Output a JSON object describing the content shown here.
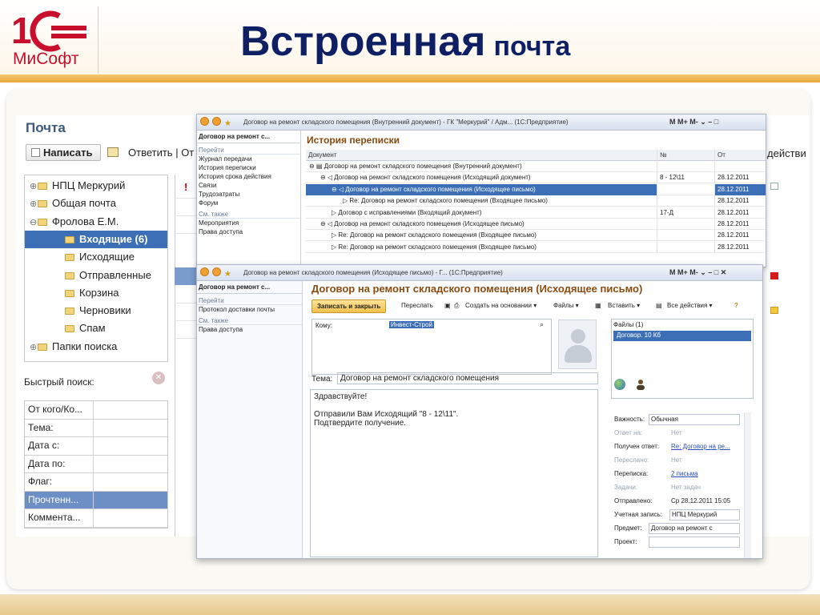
{
  "slide": {
    "title_main": "Встроенная",
    "title_sub": "почта",
    "logo_text": "МиСофт"
  },
  "mail": {
    "title": "Почта",
    "compose_label": "Написать",
    "reply_label": "Ответить",
    "reply_tail": "От",
    "right_edge_label": "действи",
    "folders": [
      {
        "label": "НПЦ Меркурий",
        "expander": "⊕",
        "selected": false,
        "indent": 0
      },
      {
        "label": "Общая почта",
        "expander": "⊕",
        "selected": false,
        "indent": 0
      },
      {
        "label": "Фролова Е.М.",
        "expander": "⊖",
        "selected": false,
        "indent": 0
      },
      {
        "label": "Входящие (6)",
        "expander": "",
        "selected": true,
        "indent": 1
      },
      {
        "label": "Исходящие",
        "expander": "",
        "selected": false,
        "indent": 1
      },
      {
        "label": "Отправленные",
        "expander": "",
        "selected": false,
        "indent": 1
      },
      {
        "label": "Корзина",
        "expander": "",
        "selected": false,
        "indent": 1
      },
      {
        "label": "Черновики",
        "expander": "",
        "selected": false,
        "indent": 1
      },
      {
        "label": "Спам",
        "expander": "",
        "selected": false,
        "indent": 1
      },
      {
        "label": "Папки поиска",
        "expander": "⊕",
        "selected": false,
        "indent": 0
      }
    ],
    "quick_search_label": "Быстрый поиск:",
    "filters": [
      {
        "label": "От кого/Ко...",
        "selected": false
      },
      {
        "label": "Тема:",
        "selected": false
      },
      {
        "label": "Дата с:",
        "selected": false
      },
      {
        "label": "Дата по:",
        "selected": false
      },
      {
        "label": "Флаг:",
        "selected": false
      },
      {
        "label": "Прочтенн...",
        "selected": true
      },
      {
        "label": "Коммента...",
        "selected": false
      }
    ],
    "flag_mark": "!"
  },
  "history_window": {
    "titlebar": "Договор на ремонт складского помещения (Внутренний документ) - ГК \"Меркурий\" / Адм... (1С:Предприятие)",
    "tb_right": "M  M+  M-  ⌄  –  □",
    "nav_head": "Договор на ремонт с...",
    "nav_section1": "Перейти",
    "nav_links1": [
      "Журнал передачи",
      "История переписки",
      "История срока действия",
      "Связи",
      "Трудозатраты",
      "Форум"
    ],
    "nav_section2": "См. также",
    "nav_links2": [
      "Мероприятия",
      "Права доступа"
    ],
    "title": "История переписки",
    "headers": {
      "doc": "Документ",
      "num": "№",
      "date": "От"
    },
    "rows": [
      {
        "doc": "⊖ ▤ Договор на ремонт складского помещения (Внутренний документ)",
        "num": "",
        "date": "",
        "indent": 0,
        "selected": false
      },
      {
        "doc": "⊖ ◁ Договор на ремонт складского помещения (Исходящий документ)",
        "num": "8 - 12\\11",
        "date": "28.12.2011",
        "indent": 1,
        "selected": false
      },
      {
        "doc": "⊖ ◁ Договор на ремонт складского помещения (Исходящее письмо)",
        "num": "",
        "date": "28.12.2011",
        "indent": 2,
        "selected": true
      },
      {
        "doc": "▷ Re: Договор на ремонт складского помещения (Входящее письмо)",
        "num": "",
        "date": "28.12.2011",
        "indent": 3,
        "selected": false
      },
      {
        "doc": "▷ Договор с исправлениями (Входящий документ)",
        "num": "17-Д",
        "date": "28.12.2011",
        "indent": 2,
        "selected": false
      },
      {
        "doc": "⊖ ◁ Договор на ремонт складского помещения (Исходящее письмо)",
        "num": "",
        "date": "28.12.2011",
        "indent": 1,
        "selected": false
      },
      {
        "doc": "▷ Re: Договор на ремонт складского помещения (Входящее письмо)",
        "num": "",
        "date": "28.12.2011",
        "indent": 2,
        "selected": false
      },
      {
        "doc": "▷ Re: Договор на ремонт складского помещения (Входящее письмо)",
        "num": "",
        "date": "28.12.2011",
        "indent": 2,
        "selected": false
      }
    ]
  },
  "letter_window": {
    "titlebar": "Договор на ремонт складского помещения (Исходящее письмо) - Г... (1С:Предприятие)",
    "tb_right": "M  M+  M-  ⌄  –  □  ✕",
    "nav_head": "Договор на ремонт с...",
    "nav_section1": "Перейти",
    "nav_links1": [
      "Протокол доставки почты"
    ],
    "nav_section2": "См. также",
    "nav_links2": [
      "Права доступа"
    ],
    "title": "Договор на ремонт складского помещения (Исходящее письмо)",
    "toolbar": {
      "save_close": "Записать и закрыть",
      "forward": "Переслать",
      "create_based": "Создать на основании ▾",
      "files": "Файлы ▾",
      "insert": "Вставить ▾",
      "all_actions": "Все действия ▾",
      "help": "?"
    },
    "to_label": "Кому:",
    "to_value": "Инвест-Строй",
    "files_head": "Файлы (1)",
    "files_item": "Договор. 10 Кб",
    "subject_label": "Тема:",
    "subject_value": "Договор на ремонт складского помещения",
    "body_lines": [
      "Здравствуйте!",
      "",
      "Отправили Вам Исходящий \"8 - 12\\11\".",
      "Подтвердите получение."
    ],
    "props": [
      {
        "label": "Важность:",
        "value": "Обычная",
        "kind": "field",
        "disabled": false
      },
      {
        "label": "Ответ на:",
        "value": "Нет",
        "kind": "text",
        "disabled": true
      },
      {
        "label": "Получен ответ:",
        "value": "Re: Договор на ре...",
        "kind": "link",
        "disabled": false
      },
      {
        "label": "Переслано:",
        "value": "Нет",
        "kind": "text",
        "disabled": true
      },
      {
        "label": "Переписка:",
        "value": "2 письма",
        "kind": "link",
        "disabled": false
      },
      {
        "label": "Задачи:",
        "value": "Нет задач",
        "kind": "text",
        "disabled": true
      },
      {
        "label": "Отправлено:",
        "value": "Ср 28.12.2011 15:05",
        "kind": "text",
        "disabled": false
      },
      {
        "label": "Учетная запись:",
        "value": "НПЦ Меркурий",
        "kind": "field",
        "disabled": false
      },
      {
        "label": "Предмет:",
        "value": "Договор на ремонт с",
        "kind": "field",
        "disabled": false
      },
      {
        "label": "Проект:",
        "value": "",
        "kind": "field",
        "disabled": false
      }
    ]
  },
  "colors": {
    "title_navy": "#0f1f64",
    "selection_blue": "#3d6fb6",
    "window_title_brown": "#8a4b10",
    "logo_red": "#c8102e"
  }
}
